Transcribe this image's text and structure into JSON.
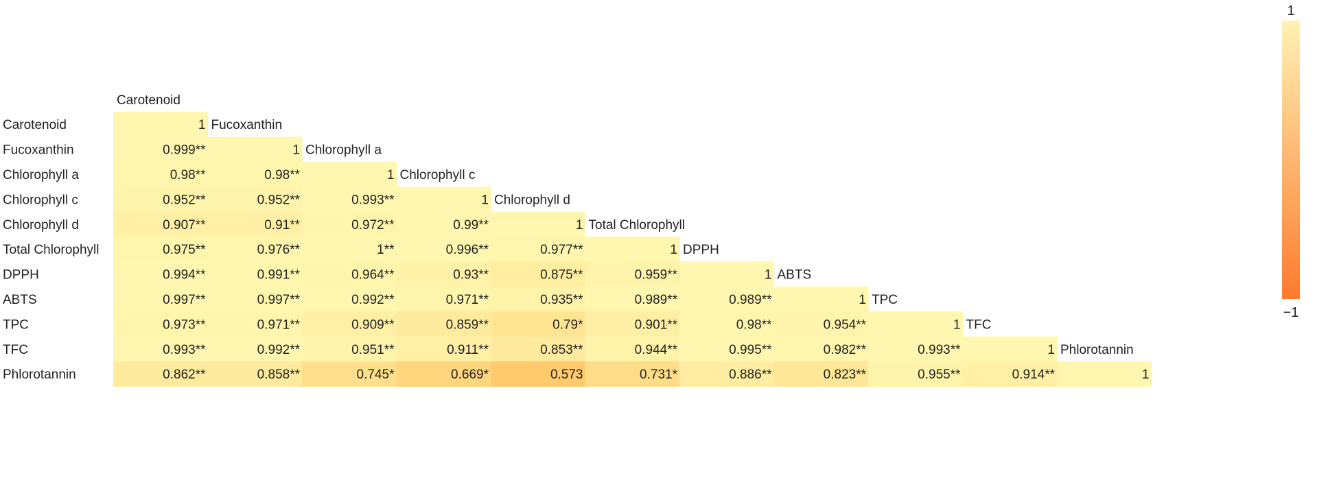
{
  "chart_data": {
    "type": "heatmap",
    "variables": [
      "Carotenoid",
      "Fucoxanthin",
      "Chlorophyll a",
      "Chlorophyll c",
      "Chlorophyll d",
      "Total Chlorophyll",
      "DPPH",
      "ABTS",
      "TPC",
      "TFC",
      "Phlorotannin"
    ],
    "values": [
      [
        1
      ],
      [
        0.999,
        1
      ],
      [
        0.98,
        0.98,
        1
      ],
      [
        0.952,
        0.952,
        0.993,
        1
      ],
      [
        0.907,
        0.91,
        0.972,
        0.99,
        1
      ],
      [
        0.975,
        0.976,
        1,
        0.996,
        0.977,
        1
      ],
      [
        0.994,
        0.991,
        0.964,
        0.93,
        0.875,
        0.959,
        1
      ],
      [
        0.997,
        0.997,
        0.992,
        0.971,
        0.935,
        0.989,
        0.989,
        1
      ],
      [
        0.973,
        0.971,
        0.909,
        0.859,
        0.79,
        0.901,
        0.98,
        0.954,
        1
      ],
      [
        0.993,
        0.992,
        0.951,
        0.911,
        0.853,
        0.944,
        0.995,
        0.982,
        0.993,
        1
      ],
      [
        0.862,
        0.858,
        0.745,
        0.669,
        0.573,
        0.731,
        0.886,
        0.823,
        0.955,
        0.914,
        1
      ]
    ],
    "cell_labels": [
      [
        "1"
      ],
      [
        "0.999**",
        "1"
      ],
      [
        "0.98**",
        "0.98**",
        "1"
      ],
      [
        "0.952**",
        "0.952**",
        "0.993**",
        "1"
      ],
      [
        "0.907**",
        "0.91**",
        "0.972**",
        "0.99**",
        "1"
      ],
      [
        "0.975**",
        "0.976**",
        "1**",
        "0.996**",
        "0.977**",
        "1"
      ],
      [
        "0.994**",
        "0.991**",
        "0.964**",
        "0.93**",
        "0.875**",
        "0.959**",
        "1"
      ],
      [
        "0.997**",
        "0.997**",
        "0.992**",
        "0.971**",
        "0.935**",
        "0.989**",
        "0.989**",
        "1"
      ],
      [
        "0.973**",
        "0.971**",
        "0.909**",
        "0.859**",
        "0.79*",
        "0.901**",
        "0.98**",
        "0.954**",
        "1"
      ],
      [
        "0.993**",
        "0.992**",
        "0.951**",
        "0.911**",
        "0.853**",
        "0.944**",
        "0.995**",
        "0.982**",
        "0.993**",
        "1"
      ],
      [
        "0.862**",
        "0.858**",
        "0.745*",
        "0.669*",
        "0.573",
        "0.731*",
        "0.886**",
        "0.823**",
        "0.955**",
        "0.914**",
        "1"
      ]
    ],
    "colorbar": {
      "max_label": "1",
      "min_label": "−1",
      "range": [
        -1,
        1
      ],
      "color_high": "#fff2b3",
      "color_low": "#ff7a2e"
    },
    "cell_colors": {
      "high": "#fff7b0",
      "low": "#ffc766"
    },
    "text_color": "#222222"
  }
}
